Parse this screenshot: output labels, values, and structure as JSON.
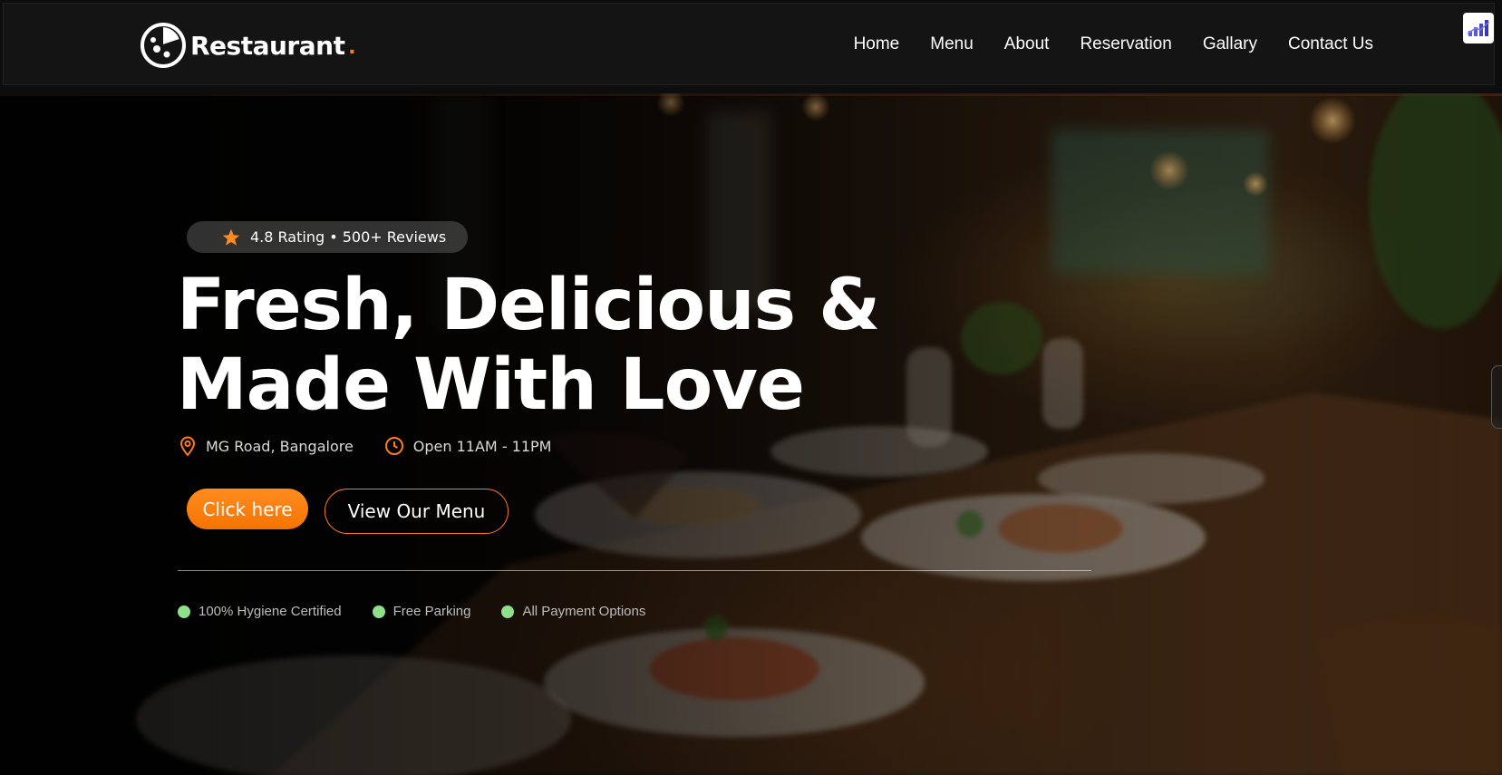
{
  "brand": {
    "name": "Restaurant",
    "dot": ".",
    "logo_icon": "pizza-icon",
    "accent": "#ff7a1a"
  },
  "nav": {
    "links": [
      "Home",
      "Menu",
      "About",
      "Reservation",
      "Gallary",
      "Contact Us"
    ]
  },
  "extension_icon": "chart-bars-icon",
  "hero": {
    "rating_text": "4.8 Rating • 500+ Reviews",
    "headline_line1": "Fresh, Delicious &",
    "headline_line2": "Made With Love",
    "location": "MG Road, Bangalore",
    "hours": "Open 11AM - 11PM",
    "primary_button": "Click here",
    "secondary_button": "View Our Menu",
    "features": [
      "100% Hygiene Certified",
      "Free Parking",
      "All Payment Options"
    ]
  }
}
